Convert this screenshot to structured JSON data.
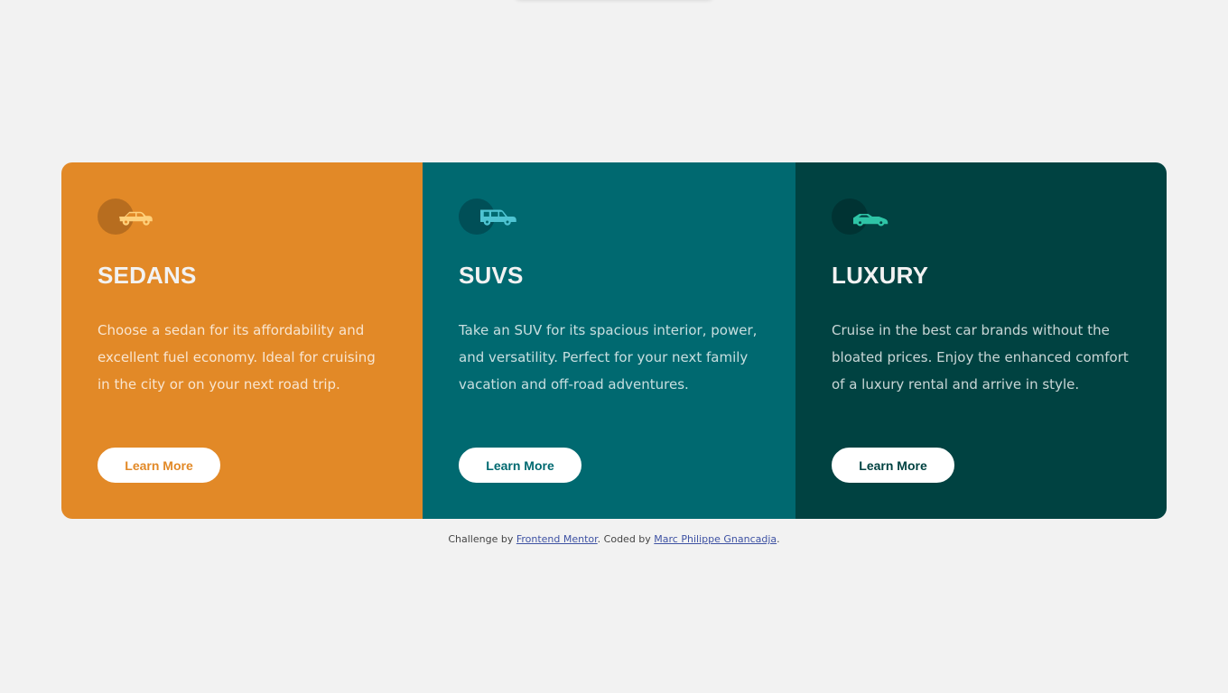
{
  "cards": [
    {
      "title": "SEDANS",
      "text": "Choose a sedan for its affordability and excellent fuel economy. Ideal for cruising in the city or on your next road trip.",
      "button": "Learn More",
      "icon": "sedan-car-icon",
      "accent": "#e28927"
    },
    {
      "title": "SUVS",
      "text": "Take an SUV for its spacious interior, power, and versatility. Perfect for your next family vacation and off-road adventures.",
      "button": "Learn More",
      "icon": "suv-car-icon",
      "accent": "#006970"
    },
    {
      "title": "LUXURY",
      "text": "Cruise in the best car brands without the bloated prices. Enjoy the enhanced comfort of a luxury rental and arrive in style.",
      "button": "Learn More",
      "icon": "luxury-car-icon",
      "accent": "#004241"
    }
  ],
  "footer": {
    "prefix": "Challenge by",
    "link1": "Frontend Mentor",
    "middle": ". Coded by",
    "link2": "Marc Philippe Gnancadja",
    "suffix": "."
  },
  "colors": {
    "background": "#f2f2f2",
    "sedans": "#e28927",
    "suvs": "#006970",
    "luxury": "#004241",
    "link": "#3e52a3"
  }
}
